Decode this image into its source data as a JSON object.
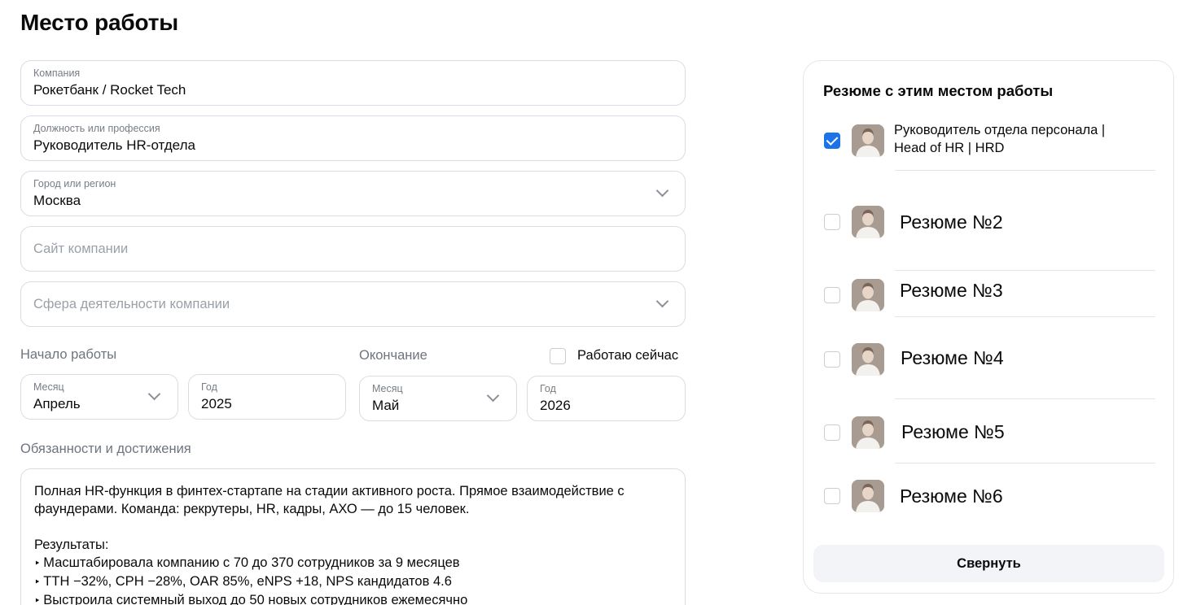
{
  "page_title": "Место работы",
  "company": {
    "label": "Компания",
    "value": "Рокетбанк / Rocket Tech"
  },
  "position": {
    "label": "Должность или профессия",
    "value": "Руководитель HR-отдела"
  },
  "city": {
    "label": "Город или регион",
    "value": "Москва"
  },
  "website": {
    "placeholder": "Сайт компании"
  },
  "industry": {
    "placeholder": "Сфера деятельности компании"
  },
  "start": {
    "label": "Начало работы",
    "month_label": "Месяц",
    "month_value": "Апрель",
    "year_label": "Год",
    "year_value": "2025"
  },
  "end": {
    "label": "Окончание",
    "month_label": "Месяц",
    "month_value": "Май",
    "year_label": "Год",
    "year_value": "2026"
  },
  "working_now": {
    "label": "Работаю сейчас",
    "checked": false
  },
  "duties": {
    "label": "Обязанности и достижения",
    "lines": [
      "Полная HR-функция в финтех-стартапе на стадии активного роста. Прямое взаимодействие с",
      "фаундерами. Команда: рекрутеры, HR, кадры, АХО — до 15 человек.",
      "",
      "Результаты:",
      "Масштабировала компанию с 70 до 370 сотрудников за 9 месяцев",
      "TTH −32%, CPH −28%, OAR 85%, eNPS +18, NPS кандидатов 4.6",
      "Выстроила системный выход до 50 новых сотрудников ежемесячно"
    ]
  },
  "resumes_panel": {
    "title": "Резюме с этим местом работы",
    "items": [
      {
        "title_line1": "Руководитель отдела персонала |",
        "title_line2": "Head of HR | HRD",
        "checked": true
      },
      {
        "title": "Резюме №2",
        "checked": false
      },
      {
        "title": "Резюме №3",
        "checked": false
      },
      {
        "title": "Резюме №4",
        "checked": false
      },
      {
        "title": "Резюме №5",
        "checked": false
      },
      {
        "title": "Резюме №6",
        "checked": false
      }
    ],
    "collapse_label": "Свернуть"
  },
  "colors": {
    "accent": "#1a73e8",
    "border": "#d9dde3",
    "muted_text": "#767d86",
    "button_bg": "#f2f4f7"
  },
  "icons": [
    "chevron-down-icon",
    "checkbox-icon",
    "avatar-photo"
  ]
}
